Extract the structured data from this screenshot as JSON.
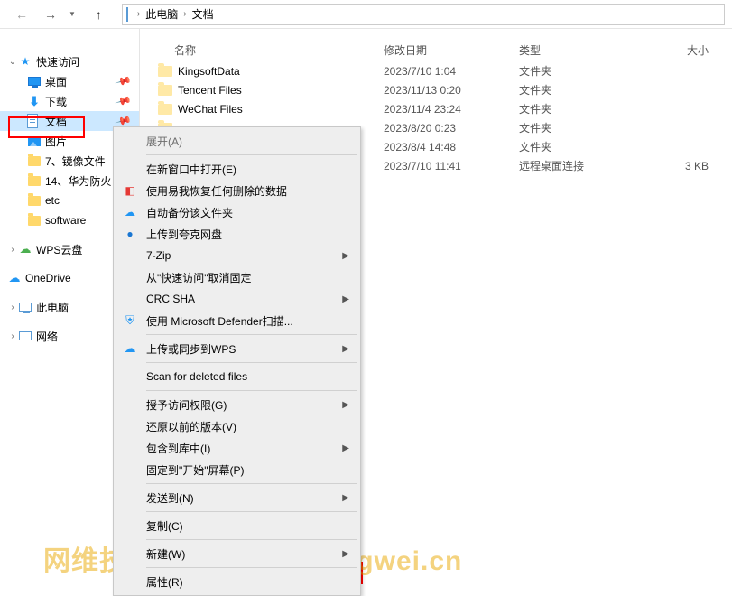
{
  "breadcrumb": {
    "root": "此电脑",
    "current": "文档"
  },
  "sidebar": {
    "quick_access": "快速访问",
    "desktop": "桌面",
    "downloads": "下载",
    "documents": "文档",
    "pictures": "图片",
    "item7": "7、镜像文件",
    "item14": "14、华为防火",
    "etc": "etc",
    "software": "software",
    "wps_cloud": "WPS云盘",
    "onedrive": "OneDrive",
    "this_pc": "此电脑",
    "network": "网络"
  },
  "columns": {
    "name": "名称",
    "date": "修改日期",
    "type": "类型",
    "size": "大小"
  },
  "rows": [
    {
      "name": "KingsoftData",
      "date": "2023/7/10 1:04",
      "type": "文件夹",
      "size": ""
    },
    {
      "name": "Tencent Files",
      "date": "2023/11/13 0:20",
      "type": "文件夹",
      "size": ""
    },
    {
      "name": "WeChat Files",
      "date": "2023/11/4 23:24",
      "type": "文件夹",
      "size": ""
    },
    {
      "name": "",
      "date": "2023/8/20 0:23",
      "type": "文件夹",
      "size": ""
    },
    {
      "name": "",
      "date": "2023/8/4 14:48",
      "type": "文件夹",
      "size": ""
    },
    {
      "name": "",
      "date": "2023/7/10 11:41",
      "type": "远程桌面连接",
      "size": "3 KB"
    }
  ],
  "ctx": {
    "expand": "展开(A)",
    "open_new_window": "在新窗口中打开(E)",
    "easy_recovery": "使用易我恢复任何删除的数据",
    "auto_backup": "自动备份该文件夹",
    "upload_kuake": "上传到夸克网盘",
    "seven_zip": "7-Zip",
    "unpin_quick": "从\"快速访问\"取消固定",
    "crc_sha": "CRC SHA",
    "defender": "使用 Microsoft Defender扫描...",
    "upload_wps": "上传或同步到WPS",
    "scan_deleted": "Scan for deleted files",
    "grant_access": "授予访问权限(G)",
    "restore_prev": "还原以前的版本(V)",
    "include_lib": "包含到库中(I)",
    "pin_start": "固定到\"开始\"屏幕(P)",
    "send_to": "发送到(N)",
    "copy": "复制(C)",
    "new": "新建(W)",
    "properties": "属性(R)"
  },
  "watermark": "网维技术|尽在www.iwangwei.cn"
}
